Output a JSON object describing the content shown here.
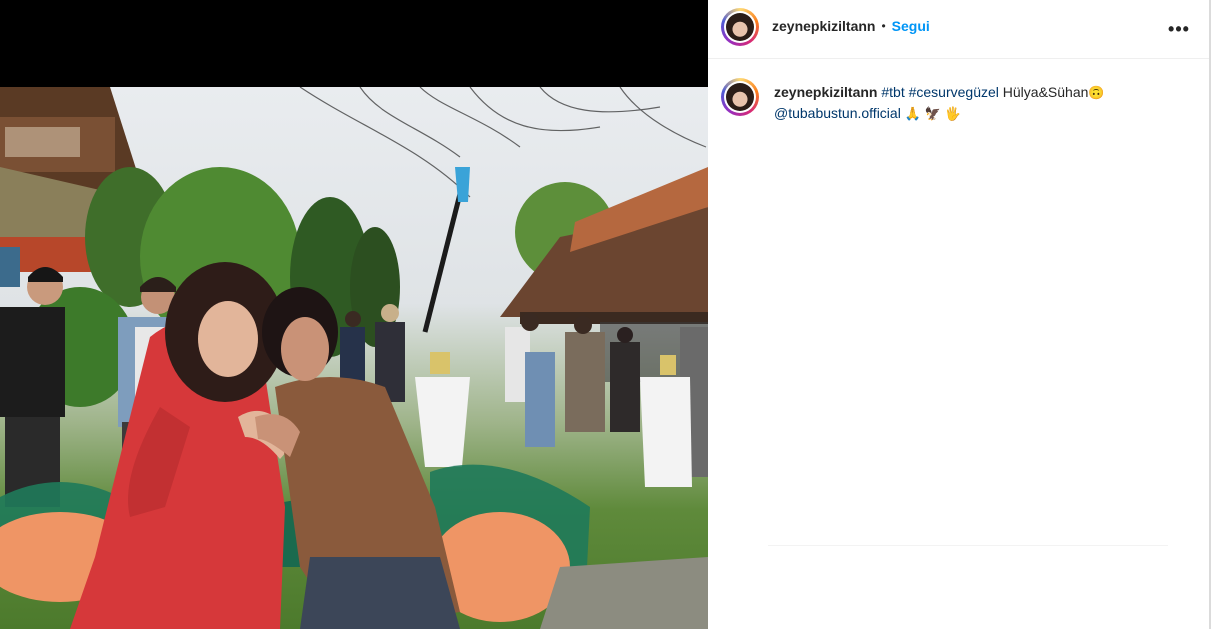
{
  "post": {
    "username": "zeynepkiziltann",
    "separator": "•",
    "follow_label": "Segui",
    "more_icon": "more-options-icon",
    "caption": {
      "username": "zeynepkiziltann",
      "hashtag_1": "#tbt",
      "hashtag_2": "#cesurvegüzel",
      "text": "Hülya&Sühan",
      "emoji_1": "🙃",
      "mention": "@tubabustun.official",
      "emoji_2": "🙏",
      "emoji_3": "🦅",
      "emoji_4": "🖐"
    }
  },
  "colors": {
    "accent_link": "#0095f6",
    "tag_link": "#00376b",
    "text": "#262626",
    "media_background": "#000000"
  }
}
